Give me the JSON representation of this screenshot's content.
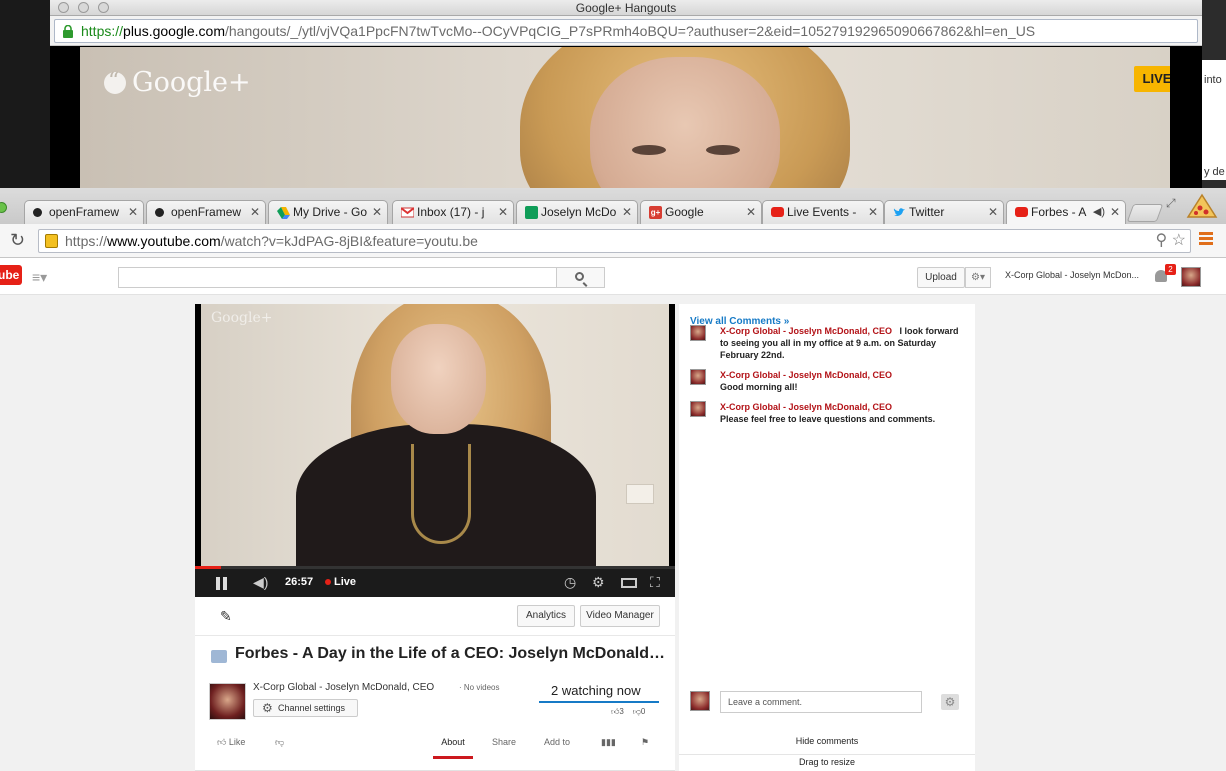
{
  "hangouts_window": {
    "title": "Google+ Hangouts",
    "url_https": "https://",
    "url_host": "plus.google.com",
    "url_path": "/hangouts/_/ytl/vjVQa1PpcFN7twTvcMo--OCyVPqCIG_P7sPRmh4oBQU=?authuser=2&eid=105279192965090667862&hl=en_US",
    "logo_text": "Google+",
    "live_badge": "LIVE",
    "side_text_1": "into",
    "side_text_2": "y de"
  },
  "browser": {
    "tabs": [
      {
        "label": "openFramew",
        "icon": "openframeworks-icon"
      },
      {
        "label": "openFramew",
        "icon": "openframeworks-icon"
      },
      {
        "label": "My Drive - Go",
        "icon": "google-drive-icon"
      },
      {
        "label": "Inbox (17) - j",
        "icon": "gmail-icon"
      },
      {
        "label": "Joselyn McDo",
        "icon": "google-sheets-icon"
      },
      {
        "label": "Google",
        "icon": "google-plus-icon"
      },
      {
        "label": "Live Events -",
        "icon": "youtube-icon"
      },
      {
        "label": "Twitter",
        "icon": "twitter-icon"
      },
      {
        "label": "Forbes - A",
        "icon": "youtube-icon"
      }
    ],
    "url_https": "https://",
    "url_host": "www.youtube.com",
    "url_path": "/watch?v=kJdPAG-8jBI&feature=youtu.be"
  },
  "youtube": {
    "logo": "ube",
    "upload_label": "Upload",
    "account_name": "X-Corp Global - Joselyn McDon...",
    "notification_count": "2",
    "watermark": "Google+",
    "player": {
      "time": "26:57",
      "live_label": "Live",
      "progress_fraction": 0.055
    },
    "analytics_label": "Analytics",
    "video_manager_label": "Video Manager",
    "title": "Forbes - A Day in the Life of a CEO: Joselyn McDonald, X-Corp Global",
    "channel_name": "X-Corp Global - Joselyn McDonald, CEO",
    "video_count": "· No videos",
    "channel_settings_label": "Channel settings",
    "watching": "2 watching now",
    "likes": "3",
    "dislikes": "0",
    "actions": {
      "like": "Like",
      "about": "About",
      "share": "Share",
      "add_to": "Add to"
    }
  },
  "chat": {
    "view_all": "View all Comments »",
    "comments": [
      {
        "author": "X-Corp Global - Joselyn McDonald, CEO",
        "text": "I look forward to seeing you all in my office at 9 a.m. on Saturday February 22nd."
      },
      {
        "author": "X-Corp Global - Joselyn McDonald, CEO",
        "text": "Good morning all!"
      },
      {
        "author": "X-Corp Global - Joselyn McDonald, CEO",
        "text": "Please feel free to leave questions and comments."
      }
    ],
    "input_placeholder": "Leave a comment.",
    "hide_comments": "Hide comments",
    "drag_resize": "Drag to resize"
  },
  "colors": {
    "youtube_red": "#e62117",
    "live_yellow": "#f7b500",
    "link_blue": "#167ac6",
    "author_red": "#b31217"
  }
}
